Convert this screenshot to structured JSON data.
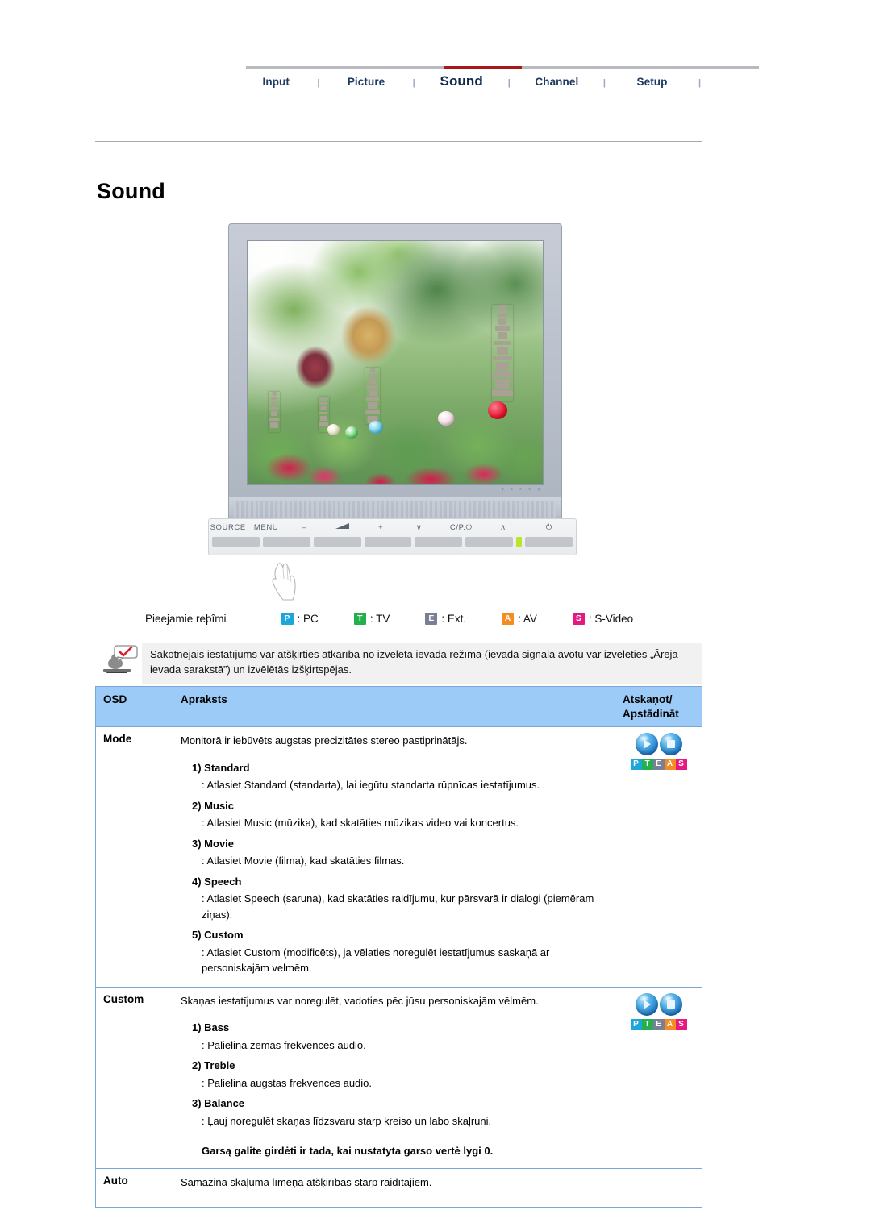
{
  "nav": {
    "items": [
      {
        "label": "Input",
        "active": false
      },
      {
        "label": "Picture",
        "active": false
      },
      {
        "label": "Sound",
        "active": true
      },
      {
        "label": "Channel",
        "active": false
      },
      {
        "label": "Setup",
        "active": false
      }
    ],
    "separator": "|",
    "active_color": "#a81818",
    "link_color": "#1d3a63"
  },
  "page": {
    "title": "Sound"
  },
  "monitor": {
    "controls": {
      "source": "SOURCE",
      "menu": "MENU",
      "minus": "–",
      "volume": "volume-icon",
      "plus": "+",
      "down": "∨",
      "channel": "C/P.⏻",
      "up": "∧",
      "power": "⏻"
    },
    "led_color": "#b7e72a"
  },
  "modes": {
    "lead_label": "Pieejamie reþîmi",
    "items": [
      {
        "badge": "P",
        "label": ": PC",
        "color": "#1ca6da"
      },
      {
        "badge": "T",
        "label": ": TV",
        "color": "#22b14c"
      },
      {
        "badge": "E",
        "label": ": Ext.",
        "color": "#7b7f95"
      },
      {
        "badge": "A",
        "label": ": AV",
        "color": "#f58b22"
      },
      {
        "badge": "S",
        "label": ": S-Video",
        "color": "#e5197f"
      }
    ]
  },
  "note": {
    "icon": "person-with-checkmark-bubble-icon",
    "text": "Sākotnējais iestatījums var atšķirties atkarībā no izvēlētā ievada režīma (ievada signāla avotu var izvēlēties „Ārējā ievada sarakstā”) un izvēlētās izšķirtspējas."
  },
  "table": {
    "headers": {
      "osd": "OSD",
      "description": "Apraksts",
      "play_stop": "Atskaņot/ Apstādināt"
    },
    "rows": [
      {
        "name": "Mode",
        "lead": "Monitorā ir iebūvēts augstas precizitātes stereo pastiprinātājs.",
        "options": [
          {
            "title": "1) Standard",
            "body": ": Atlasiet Standard (standarta), lai iegūtu standarta rūpnīcas iestatījumus."
          },
          {
            "title": "2) Music",
            "body": ": Atlasiet Music (mūzika), kad skatāties mūzikas video vai koncertus."
          },
          {
            "title": "3) Movie",
            "body": ": Atlasiet Movie (filma), kad skatāties filmas."
          },
          {
            "title": "4) Speech",
            "body": ": Atlasiet Speech (saruna), kad skatāties raidījumu, kur pārsvarā ir dialogi (piemēram ziņas)."
          },
          {
            "title": "5) Custom",
            "body": ": Atlasiet Custom (modificēts), ja vēlaties noregulēt iestatījumus saskaņā ar personiskajām velmēm."
          }
        ],
        "hint": "",
        "has_play": true
      },
      {
        "name": "Custom",
        "lead": "Skaņas iestatījumus var noregulēt, vadoties pēc jūsu personiskajām vēlmēm.",
        "options": [
          {
            "title": "1) Bass",
            "body": ": Palielina zemas frekvences audio."
          },
          {
            "title": "2) Treble",
            "body": ": Palielina augstas frekvences audio."
          },
          {
            "title": "3) Balance",
            "body": ": Ļauj noregulēt skaņas līdzsvaru starp kreiso un labo skaļruni."
          }
        ],
        "hint": "Garsą galite girdėti ir tada, kai nustatyta garso vertė lygi 0.",
        "has_play": true
      },
      {
        "name": "Auto",
        "lead": "Samazina skaļuma līmeņa atšķirības starp raidītājiem.",
        "options": [],
        "hint": "",
        "has_play": false
      }
    ],
    "play_badges": [
      {
        "letter": "P",
        "color": "#1ca6da"
      },
      {
        "letter": "T",
        "color": "#22b14c"
      },
      {
        "letter": "E",
        "color": "#7b7f95"
      },
      {
        "letter": "A",
        "color": "#f58b22"
      },
      {
        "letter": "S",
        "color": "#e5197f"
      }
    ],
    "header_bg": "#9ccbf7",
    "border_color": "#7ba7d7"
  }
}
